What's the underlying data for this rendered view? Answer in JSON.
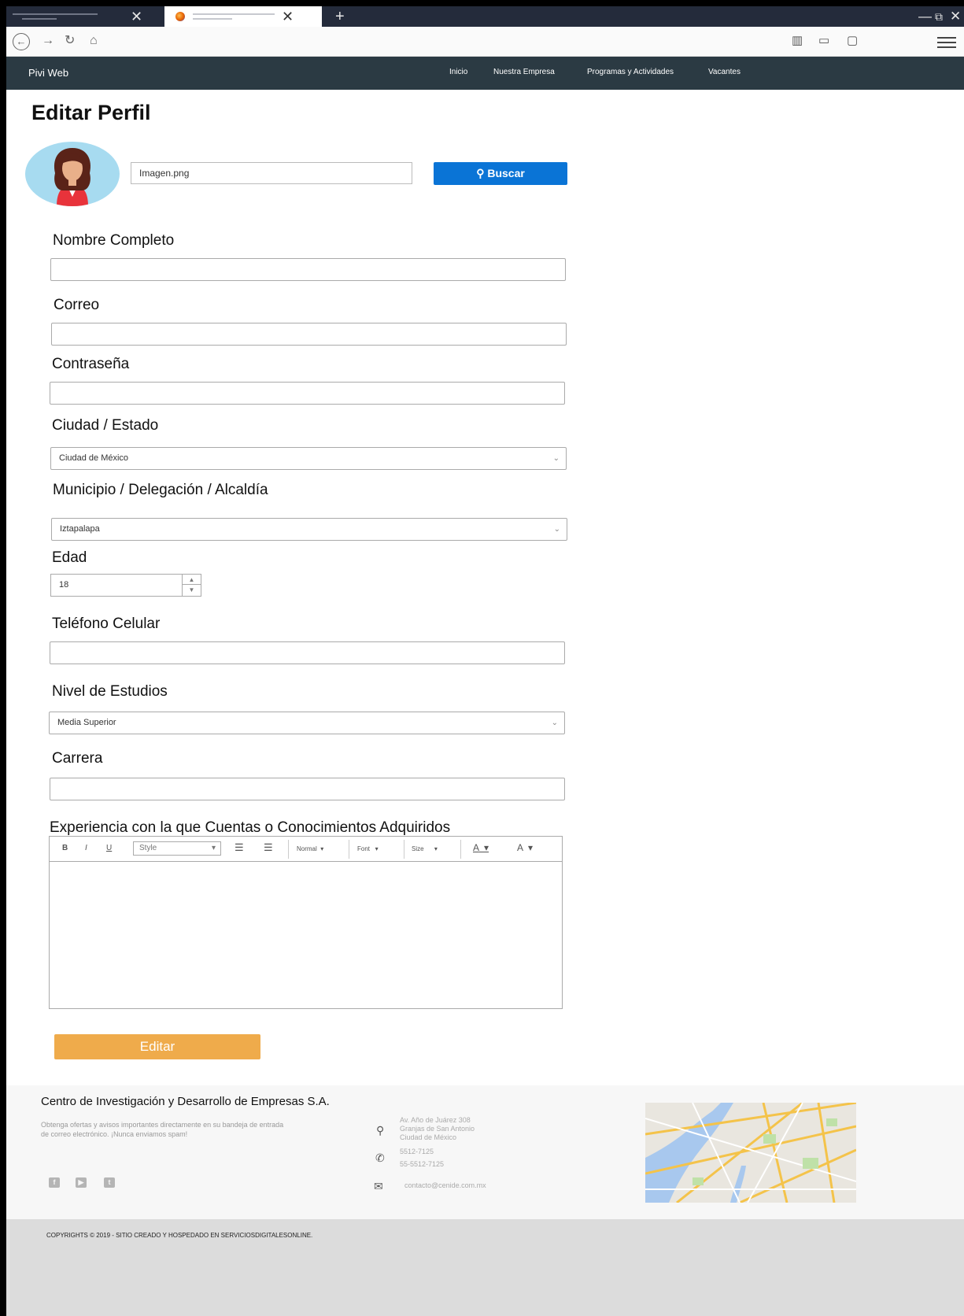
{
  "browser": {
    "tab_close": "✕",
    "new_tab": "+"
  },
  "site": {
    "brand": "Pivi Web",
    "nav": [
      "Inicio",
      "Nuestra Empresa",
      "Programas y Actividades",
      "Vacantes"
    ]
  },
  "page": {
    "title": "Editar Perfil",
    "image_file": "Imagen.png",
    "search_button": "Buscar"
  },
  "form": {
    "full_name_label": "Nombre Completo",
    "email_label": "Correo",
    "password_label": "Contraseña",
    "city_label": "Ciudad / Estado",
    "city_value": "Ciudad de México",
    "municipality_label": "Municipio / Delegación / Alcaldía",
    "municipality_value": "Iztapalapa",
    "age_label": "Edad",
    "age_value": "18",
    "phone_label": "Teléfono Celular",
    "education_label": "Nivel de Estudios",
    "education_value": "Media Superior",
    "career_label": "Carrera",
    "experience_label": "Experiencia con la que Cuentas o Conocimientos Adquiridos",
    "submit_button": "Editar"
  },
  "editor": {
    "bold": "B",
    "italic": "I",
    "underline": "U",
    "style": "Style",
    "format": "Normal",
    "font": "Font",
    "size": "Size",
    "text_color": "A",
    "bg_color": "A"
  },
  "footer": {
    "company": "Centro de Investigación y Desarrollo de Empresas S.A.",
    "newsletter": "Obtenga ofertas y avisos importantes directamente en su bandeja de entrada de correo electrónico. ¡Nunca enviamos spam!",
    "address_line1": "Av. Año de Juárez 308",
    "address_line2": "Granjas de San Antonio",
    "address_line3": "Ciudad de México",
    "phone1": "5512-7125",
    "phone2": "55-5512-7125",
    "email": "contacto@cenide.com.mx",
    "copyright": "COPYRIGHTS © 2019 - SITIO CREADO Y HOSPEDADO EN SERVICIOSDIGITALESONLINE."
  }
}
